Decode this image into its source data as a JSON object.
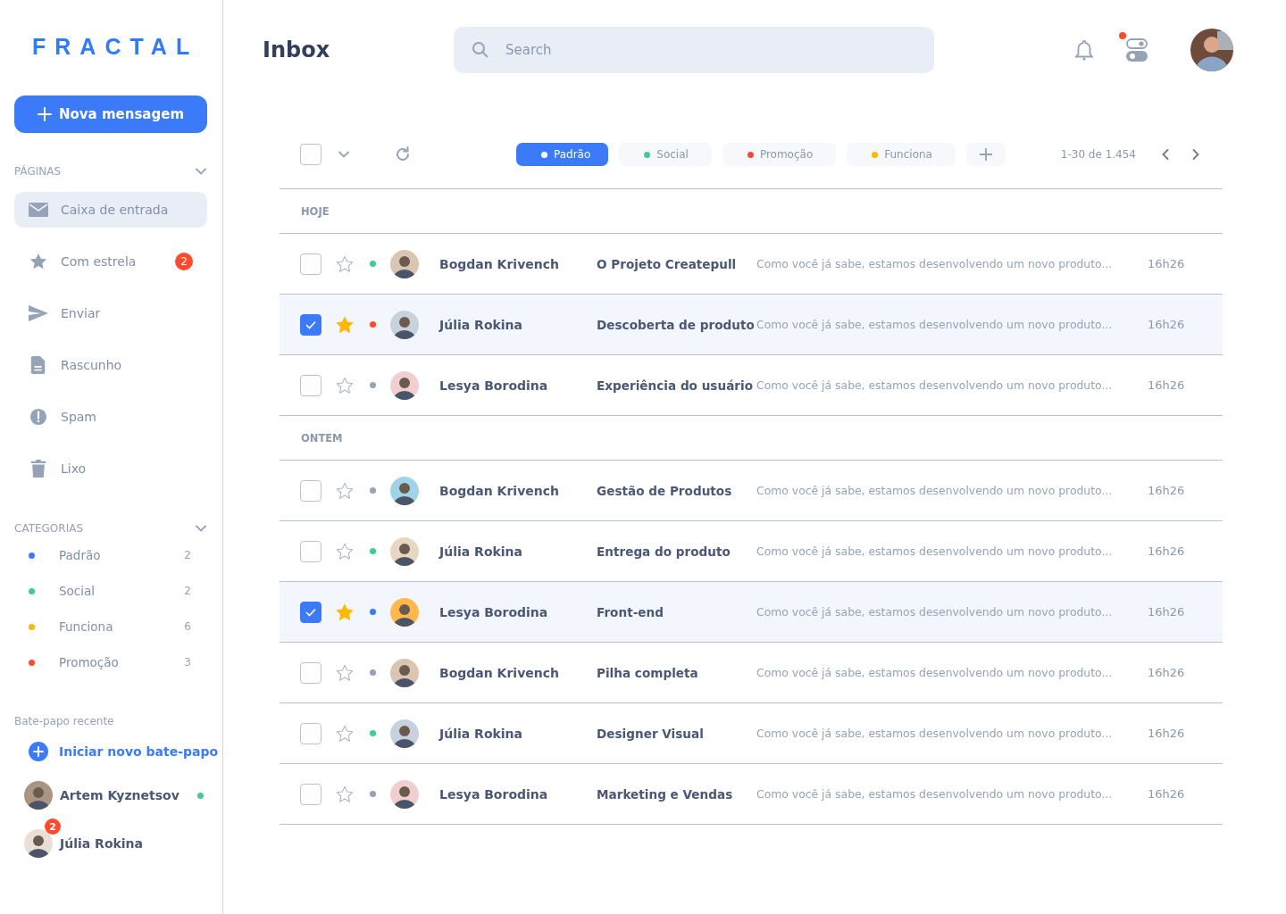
{
  "logo": "FRACTAL",
  "compose_button": "Nova mensagem",
  "pages": {
    "title": "PÁGINAS",
    "items": [
      {
        "kind": "inbox",
        "label": "Caixa de entrada",
        "selected": true
      },
      {
        "kind": "star",
        "label": "Com estrela",
        "badge": "2",
        "selected": false
      },
      {
        "kind": "send",
        "label": "Enviar",
        "selected": false
      },
      {
        "kind": "draft",
        "label": "Rascunho",
        "selected": false
      },
      {
        "kind": "spam",
        "label": "Spam",
        "selected": false
      },
      {
        "kind": "trash",
        "label": "Lixo",
        "selected": false
      }
    ]
  },
  "categories": {
    "title": "CATEGORIAS",
    "items": [
      {
        "label": "Padrão",
        "count": "2",
        "color": "#3b7bfa"
      },
      {
        "label": "Social",
        "count": "2",
        "color": "#3ecf8e"
      },
      {
        "label": "Funciona",
        "count": "6",
        "color": "#ffb800"
      },
      {
        "label": "Promoção",
        "count": "3",
        "color": "#ff4a2e"
      }
    ]
  },
  "recent_chats": {
    "title": "Bate-papo recente",
    "new_chat": "Iniciar novo bate-papo",
    "chats": [
      {
        "name": "Artem Kyznetsov",
        "online": true
      },
      {
        "name": "Júlia Rokina",
        "badge": "2"
      }
    ]
  },
  "header": {
    "title": "Inbox",
    "search": {
      "placeholder": "Search"
    },
    "settings_alert": true
  },
  "toolbar": {
    "select_all_checked": false,
    "tags": [
      {
        "label": "Padrão",
        "color": "#ffffff",
        "selected": true
      },
      {
        "label": "Social",
        "color": "#3ecf8e",
        "selected": false
      },
      {
        "label": "Promoção",
        "color": "#ff4a2e",
        "selected": false
      },
      {
        "label": "Funciona",
        "color": "#ffb800",
        "selected": false
      }
    ],
    "pagination": "1-30 de 1.454"
  },
  "groups": [
    {
      "label": "HOJE",
      "emails": [
        {
          "sender": "Bogdan Krivench",
          "subject": "O Projeto Createpull",
          "preview": "Como você já sabe, estamos desenvolvendo um novo produto...",
          "time": "16h26",
          "checked": false,
          "starred": false,
          "color": "#3ecf8e"
        },
        {
          "sender": "Júlia Rokina",
          "subject": "Descoberta de produto",
          "preview": "Como você já sabe, estamos desenvolvendo um novo produto...",
          "time": "16h26",
          "checked": true,
          "starred": true,
          "color": "#ff4a2e"
        },
        {
          "sender": "Lesya Borodina",
          "subject": "Experiência do usuário",
          "preview": "Como você já sabe, estamos desenvolvendo um novo produto...",
          "time": "16h26",
          "checked": false,
          "starred": false,
          "color": "#94a3b8"
        }
      ]
    },
    {
      "label": "ONTEM",
      "emails": [
        {
          "sender": "Bogdan Krivench",
          "subject": "Gestão de Produtos",
          "preview": "Como você já sabe, estamos desenvolvendo um novo produto...",
          "time": "16h26",
          "checked": false,
          "starred": false,
          "color": "#94a3b8"
        },
        {
          "sender": "Júlia Rokina",
          "subject": "Entrega do produto",
          "preview": "Como você já sabe, estamos desenvolvendo um novo produto...",
          "time": "16h26",
          "checked": false,
          "starred": false,
          "color": "#3ecf8e"
        },
        {
          "sender": "Lesya Borodina",
          "subject": "Front-end",
          "preview": "Como você já sabe, estamos desenvolvendo um novo produto...",
          "time": "16h26",
          "checked": true,
          "starred": true,
          "color": "#3b7bfa"
        },
        {
          "sender": "Bogdan Krivench",
          "subject": "Pilha completa",
          "preview": "Como você já sabe, estamos desenvolvendo um novo produto...",
          "time": "16h26",
          "checked": false,
          "starred": false,
          "color": "#94a3b8"
        },
        {
          "sender": "Júlia Rokina",
          "subject": "Designer Visual",
          "preview": "Como você já sabe, estamos desenvolvendo um novo produto...",
          "time": "16h26",
          "checked": false,
          "starred": false,
          "color": "#3ecf8e"
        },
        {
          "sender": "Lesya Borodina",
          "subject": "Marketing e Vendas",
          "preview": "Como você já sabe, estamos desenvolvendo um novo produto...",
          "time": "16h26",
          "checked": false,
          "starred": false,
          "color": "#94a3b8"
        }
      ]
    }
  ]
}
